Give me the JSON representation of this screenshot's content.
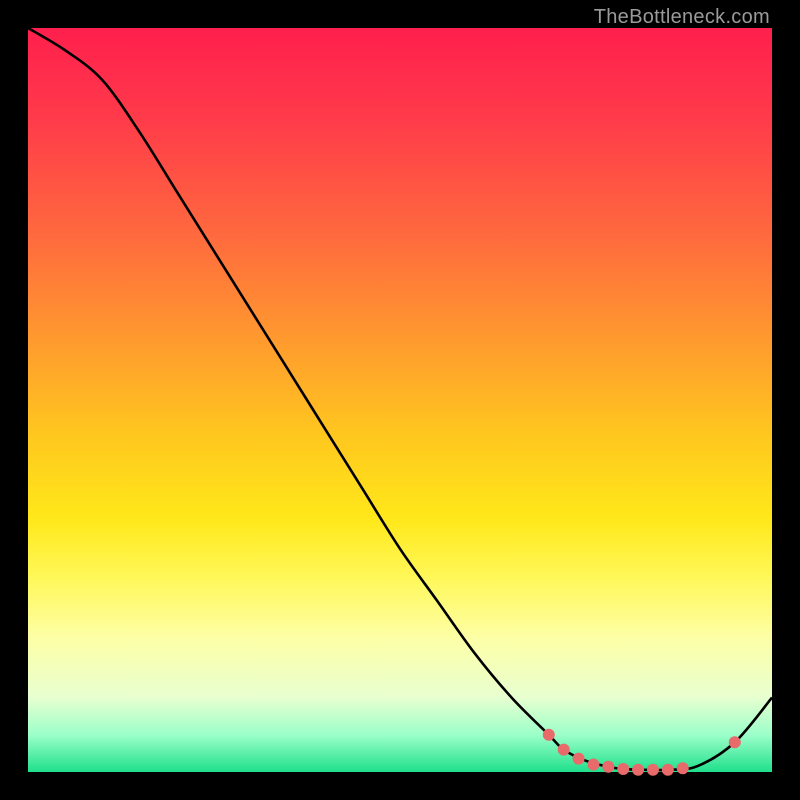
{
  "attribution": "TheBottleneck.com",
  "colors": {
    "page_bg": "#000000",
    "gradient_top": "#ff1f4d",
    "gradient_bottom": "#1fe08c",
    "curve": "#000000",
    "markers": "#e86a6a"
  },
  "chart_data": {
    "type": "line",
    "title": "",
    "xlabel": "",
    "ylabel": "",
    "xlim": [
      0,
      100
    ],
    "ylim": [
      0,
      100
    ],
    "grid": false,
    "series": [
      {
        "name": "curve",
        "x": [
          0,
          5,
          10,
          15,
          20,
          25,
          30,
          35,
          40,
          45,
          50,
          55,
          60,
          65,
          70,
          72,
          75,
          78,
          80,
          83,
          86,
          90,
          95,
          100
        ],
        "y": [
          100,
          97,
          93,
          86,
          78,
          70,
          62,
          54,
          46,
          38,
          30,
          23,
          16,
          10,
          5,
          3,
          1.5,
          0.7,
          0.4,
          0.3,
          0.3,
          0.8,
          4,
          10
        ]
      }
    ],
    "markers": [
      {
        "x": 70,
        "y": 5
      },
      {
        "x": 72,
        "y": 3
      },
      {
        "x": 74,
        "y": 1.8
      },
      {
        "x": 76,
        "y": 1.0
      },
      {
        "x": 78,
        "y": 0.7
      },
      {
        "x": 80,
        "y": 0.4
      },
      {
        "x": 82,
        "y": 0.3
      },
      {
        "x": 84,
        "y": 0.3
      },
      {
        "x": 86,
        "y": 0.3
      },
      {
        "x": 88,
        "y": 0.5
      },
      {
        "x": 95,
        "y": 4
      }
    ]
  }
}
